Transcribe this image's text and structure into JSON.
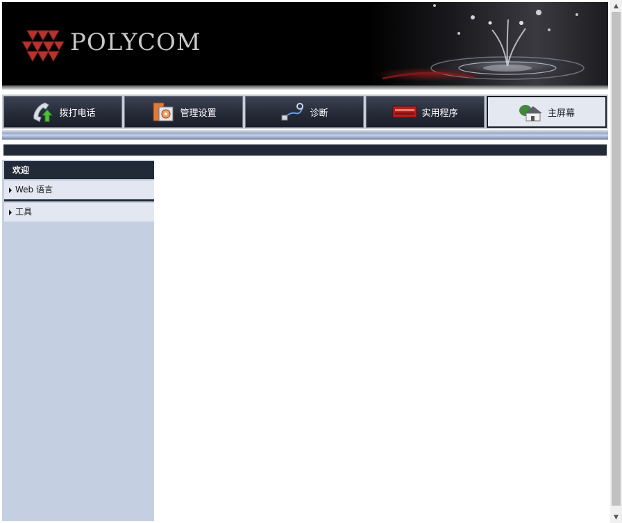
{
  "brand": {
    "logo_text": "POLYCOM",
    "logo_color": "#b8322e"
  },
  "nav": {
    "tabs": [
      {
        "label": "拨打电话",
        "icon": "phone-icon",
        "active": false
      },
      {
        "label": "管理设置",
        "icon": "admin-settings-icon",
        "active": false
      },
      {
        "label": "诊断",
        "icon": "diagnostics-icon",
        "active": false
      },
      {
        "label": "实用程序",
        "icon": "utilities-icon",
        "active": false
      },
      {
        "label": "主屏幕",
        "icon": "home-icon",
        "active": true
      }
    ]
  },
  "sidebar": {
    "header": "欢迎",
    "items": [
      {
        "label": "Web 语言"
      },
      {
        "label": "工具"
      }
    ]
  },
  "colors": {
    "dark_navy": "#232a37",
    "sidebar_bg": "#c5cfe2",
    "item_bg": "#e3e7f1"
  }
}
